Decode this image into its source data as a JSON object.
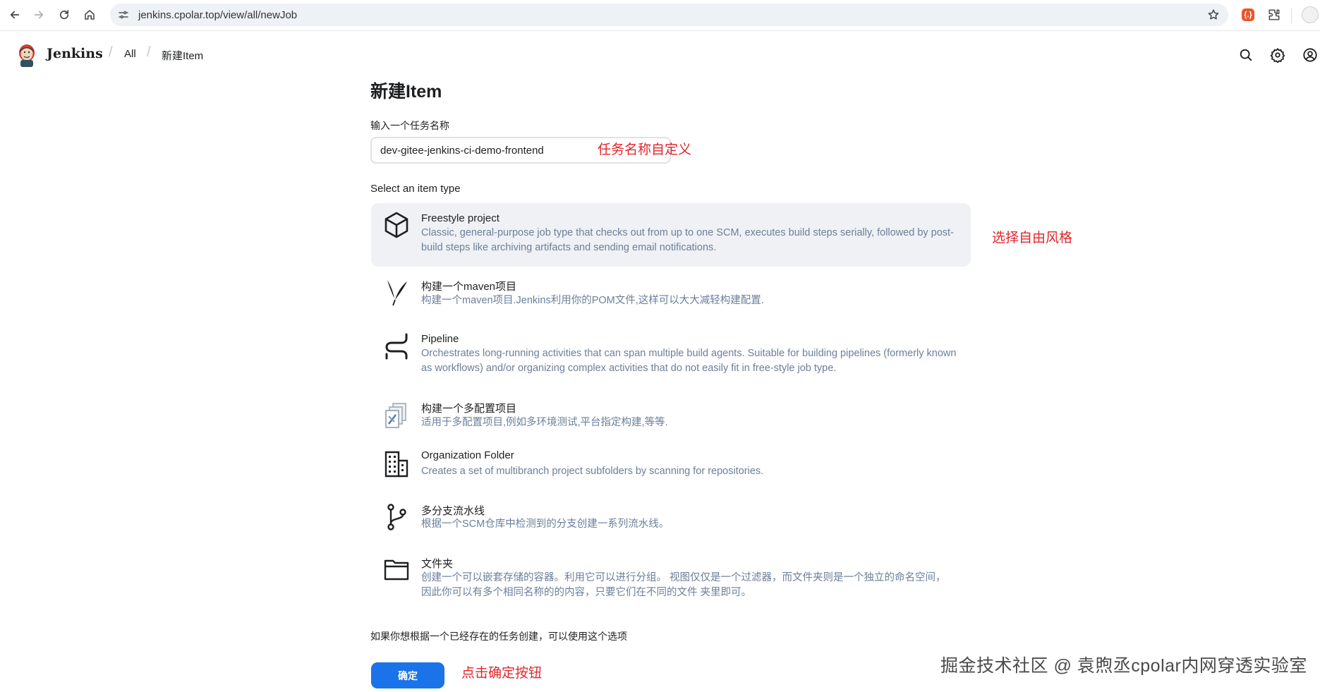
{
  "browser": {
    "url": "jenkins.cpolar.top/view/all/newJob",
    "ext_label": "{.}"
  },
  "header": {
    "brand": "Jenkins",
    "breadcrumbs": [
      "All",
      "新建Item"
    ]
  },
  "main": {
    "title": "新建Item",
    "name_label": "输入一个任务名称",
    "name_value": "dev-gitee-jenkins-ci-demo-frontend",
    "type_label": "Select an item type",
    "items": [
      {
        "title": "Freestyle project",
        "desc": "Classic, general-purpose job type that checks out from up to one SCM, executes build steps serially, followed by post-build steps like archiving artifacts and sending email notifications.",
        "icon": "cube-icon",
        "selected": true
      },
      {
        "title": "构建一个maven项目",
        "desc": "构建一个maven项目.Jenkins利用你的POM文件,这样可以大大减轻构建配置.",
        "icon": "maven-feather-icon",
        "selected": false
      },
      {
        "title": "Pipeline",
        "desc": "Orchestrates long-running activities that can span multiple build agents. Suitable for building pipelines (formerly known as workflows) and/or organizing complex activities that do not easily fit in free-style job type.",
        "icon": "pipeline-icon",
        "selected": false
      },
      {
        "title": "构建一个多配置项目",
        "desc": "适用于多配置项目,例如多环境测试,平台指定构建,等等.",
        "icon": "multi-config-icon",
        "selected": false
      },
      {
        "title": "Organization Folder",
        "desc": "Creates a set of multibranch project subfolders by scanning for repositories.",
        "icon": "building-icon",
        "selected": false
      },
      {
        "title": "多分支流水线",
        "desc": "根据一个SCM仓库中检测到的分支创建一系列流水线。",
        "icon": "branch-icon",
        "selected": false
      },
      {
        "title": "文件夹",
        "desc": "创建一个可以嵌套存储的容器。利用它可以进行分组。 视图仅仅是一个过滤器，而文件夹则是一个独立的命名空间， 因此你可以有多个相同名称的的内容，只要它们在不同的文件 夹里即可。",
        "icon": "folder-icon",
        "selected": false
      }
    ],
    "copy_label": "如果你想根据一个已经存在的任务创建，可以使用这个选项",
    "ok_label": "确定"
  },
  "annotations": {
    "name_note": "任务名称自定义",
    "type_note": "选择自由风格",
    "ok_note": "点击确定按钮",
    "color": "#e2262b"
  },
  "watermark": "掘金技术社区 @ 袁煦丞cpolar内网穿透实验室",
  "colors": {
    "accent": "#1a73e8",
    "desc_text": "#6b7f9a",
    "selected_bg": "#eff1f5"
  }
}
